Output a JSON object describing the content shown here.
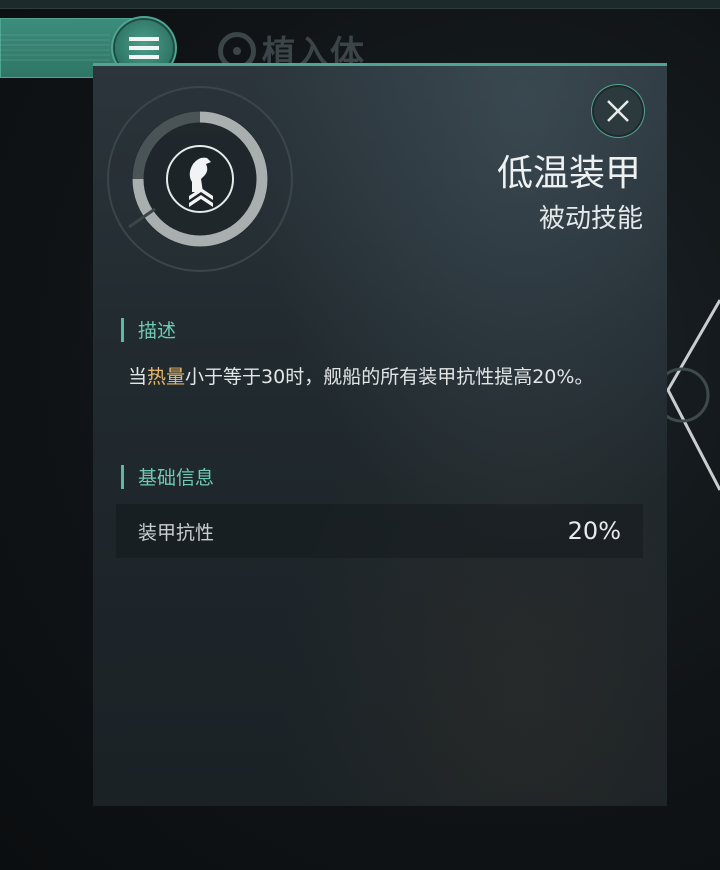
{
  "header": {
    "bg_title": "植入体"
  },
  "skill": {
    "name": "低温装甲",
    "type": "被动技能",
    "icon": "knight-chess-chevron-icon"
  },
  "description": {
    "section_title": "描述",
    "text_before": "当",
    "highlight": "热量",
    "text_after": "小于等于30时，舰船的所有装甲抗性提高20%。"
  },
  "basic_info": {
    "section_title": "基础信息",
    "rows": [
      {
        "label": "装甲抗性",
        "value": "20%"
      }
    ]
  },
  "colors": {
    "accent": "#4ea590",
    "section_text": "#6ec9b5",
    "highlight": "#e6b86a"
  }
}
